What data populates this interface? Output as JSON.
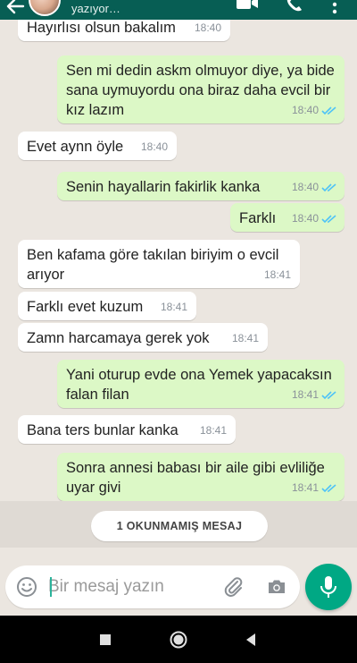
{
  "header": {
    "status": "yazıyor…",
    "icons": [
      "back-arrow-icon",
      "video-call-icon",
      "voice-call-icon",
      "more-options-icon"
    ]
  },
  "messages": [
    {
      "direction": "in",
      "text": "Hayırlısı olsun bakalım",
      "time": "18:40"
    },
    {
      "direction": "out",
      "text": "Sen mi dedin askm olmuyor diye, ya bide sana uymuyordu ona biraz daha evcil bir kız lazım",
      "time": "18:40",
      "read": true
    },
    {
      "direction": "in",
      "text": "Evet aynn öyle",
      "time": "18:40"
    },
    {
      "direction": "out",
      "text": "Senin hayallarin fakirlik kanka",
      "time": "18:40",
      "read": true
    },
    {
      "direction": "out",
      "text": "Farklı",
      "time": "18:40",
      "read": true
    },
    {
      "direction": "in",
      "text": "Ben kafama göre takılan biriyim o evcil arıyor",
      "time": "18:41"
    },
    {
      "direction": "in",
      "text": "Farklı evet kuzum",
      "time": "18:41"
    },
    {
      "direction": "in",
      "text": "Zamn harcamaya gerek yok",
      "time": "18:41"
    },
    {
      "direction": "out",
      "text": "Yani oturup evde ona Yemek yapacaksın falan filan",
      "time": "18:41",
      "read": true
    },
    {
      "direction": "in",
      "text": "Bana ters bunlar kanka",
      "time": "18:41"
    },
    {
      "direction": "out",
      "text": "Sonra annesi babası bir aile gibi evliliğe uyar givi",
      "time": "18:41",
      "read": true
    }
  ],
  "unread_banner": "1 OKUNMAMIŞ MESAJ",
  "composer": {
    "placeholder": "Bir mesaj yazın",
    "value": "",
    "icons": [
      "emoji-icon",
      "attach-icon",
      "camera-icon",
      "mic-icon"
    ]
  },
  "colors": {
    "header": "#075e54",
    "chat_background": "#ebe6e0",
    "incoming_bubble": "#ffffff",
    "outgoing_bubble": "#dcf8c6",
    "read_ticks": "#4fc3f7",
    "mic_button": "#00a884"
  },
  "navigation_bar": [
    "recents-button",
    "home-button",
    "back-button"
  ]
}
